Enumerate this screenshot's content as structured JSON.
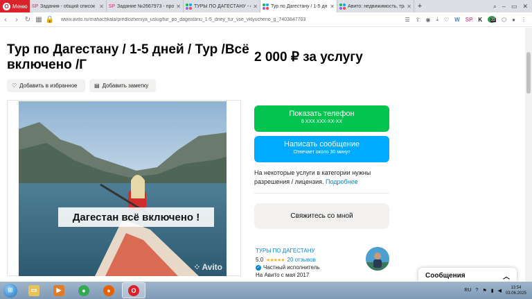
{
  "browser": {
    "menu_label": "Меню",
    "tabs": [
      {
        "icon": "sp",
        "title": "Задания - общий список"
      },
      {
        "icon": "sp",
        "title": "Задание №2667973 - про"
      },
      {
        "icon": "avito",
        "title": "ТУРЫ ПО ДАГЕСТАНУ - ос"
      },
      {
        "icon": "avito",
        "title": "Тур по Дагестану / 1-5 дн"
      },
      {
        "icon": "avito",
        "title": "Авито: недвижимость, тра"
      }
    ],
    "new_tab": "+",
    "url": "www.avito.ru/mahachkala/predlozheniya_uslug/tur_po_dagestanu_1-5_dney_tur_vse_vklyucheno_g_7403847703",
    "badge_count": "22"
  },
  "listing": {
    "title": "Тур по Дагестану / 1-5 дней / Тур /Всё включено /Г",
    "price": "2 000 ₽ за услугу",
    "add_favorite": "Добавить в избранное",
    "add_note": "Добавить заметку",
    "photo_banner": "Дагестан всё включено !",
    "watermark": "Avito"
  },
  "contact": {
    "phone_label": "Показать телефон",
    "phone_masked": "8 XXX XXX-XX-XX",
    "message_label": "Написать сообщение",
    "message_sub": "Отвечает около 30 минут",
    "license_text": "На некоторые услуги в категории нужны разрешения / лицензия.",
    "license_link": "Подробнее",
    "contact_me": "Свяжитесь со мной"
  },
  "seller": {
    "name": "ТУРЫ ПО ДАГЕСТАНУ",
    "rating": "5.0",
    "stars": "★★★★★",
    "reviews": "20 отзывов",
    "type": "Частный исполнитель",
    "since": "На Авито с мая 2017"
  },
  "messages_panel": {
    "label": "Сообщения"
  },
  "taskbar": {
    "lang": "RU",
    "time": "13:54",
    "date": "03.06.2025"
  },
  "colors": {
    "phone_button": "#02c44f",
    "message_button": "#00aaff",
    "link": "#0a85d1",
    "menu_red": "#d9222a"
  }
}
